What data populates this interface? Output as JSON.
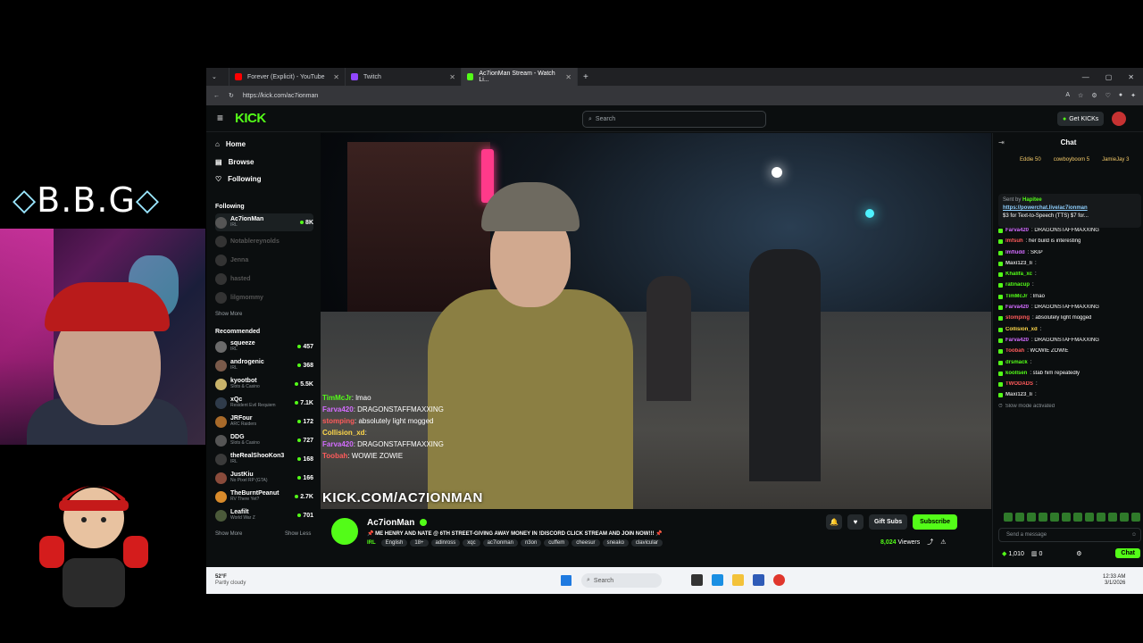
{
  "overlay": {
    "brand_text": "B.B.G"
  },
  "browser": {
    "tabs": [
      {
        "label": "Forever (Explicit) - YouTube",
        "active": false,
        "favicon_color": "#ff0000"
      },
      {
        "label": "Twitch",
        "active": false,
        "favicon_color": "#9146ff"
      },
      {
        "label": "Ac7ionMan Stream - Watch Li...",
        "active": true,
        "favicon_color": "#53fc18"
      }
    ],
    "url": "https://kick.com/ac7ionman"
  },
  "kick": {
    "logo": "KICK",
    "search_placeholder": "Search",
    "get_kicks_label": "Get KICKs",
    "nav": [
      {
        "label": "Home",
        "icon": "home-icon"
      },
      {
        "label": "Browse",
        "icon": "browse-icon"
      },
      {
        "label": "Following",
        "icon": "heart-icon"
      }
    ],
    "following_title": "Following",
    "following": [
      {
        "name": "Ac7ionMan",
        "category": "IRL",
        "viewers": "8K",
        "live": true
      },
      {
        "name": "Notablereynolds",
        "category": "",
        "viewers": "",
        "live": false
      },
      {
        "name": "Jenna",
        "category": "",
        "viewers": "",
        "live": false
      },
      {
        "name": "hasted",
        "category": "",
        "viewers": "",
        "live": false
      },
      {
        "name": "lilgmommy",
        "category": "",
        "viewers": "",
        "live": false
      }
    ],
    "show_more": "Show More",
    "recommended_title": "Recommended",
    "recommended": [
      {
        "name": "squeeze",
        "category": "IRL",
        "viewers": "457"
      },
      {
        "name": "androgenic",
        "category": "IRL",
        "viewers": "368"
      },
      {
        "name": "kyootbot",
        "category": "Slots & Casino",
        "viewers": "5.5K"
      },
      {
        "name": "xQc",
        "category": "Resident Evil Requiem",
        "viewers": "7.1K"
      },
      {
        "name": "JRFour",
        "category": "ARC Raiders",
        "viewers": "172"
      },
      {
        "name": "DDG",
        "category": "Slots & Casino",
        "viewers": "727"
      },
      {
        "name": "theRealShooKon3",
        "category": "IRL",
        "viewers": "168"
      },
      {
        "name": "JustKiu",
        "category": "No Pixel RP (GTA)",
        "viewers": "166"
      },
      {
        "name": "TheBurntPeanut",
        "category": "RV There Yet?",
        "viewers": "2.7K"
      },
      {
        "name": "Leafilt",
        "category": "World War Z",
        "viewers": "701"
      }
    ],
    "show_more_2": "Show More",
    "show_less": "Show Less"
  },
  "video": {
    "overlay_chat": [
      {
        "user": "TimMcJr",
        "text": ": lmao",
        "color": "#53fc18"
      },
      {
        "user": "Farva420",
        "text": ": DRAGONSTAFFMAXXING",
        "color": "#d36cff"
      },
      {
        "user": "stomping",
        "text": ": absolutely light mogged",
        "color": "#ff5b5b"
      },
      {
        "user": "Collision_xd",
        "text": ":",
        "color": "#ffd84a"
      },
      {
        "user": "Farva420",
        "text": ": DRAGONSTAFFMAXXING",
        "color": "#d36cff"
      },
      {
        "user": "Toobah",
        "text": ": WOWIE ZOWIE",
        "color": "#ff5b5b"
      }
    ],
    "overlay_url": "KICK.COM/AC7IONMAN"
  },
  "stream": {
    "name": "Ac7ionMan",
    "title": "📌 ME HENRY AND NATE @ 6TH STREET-GIVING AWAY MONEY IN !DISCORD CLICK STREAM AND JOIN NOW!!! 📌",
    "category": "IRL",
    "tags": [
      "English",
      "18+",
      "adinross",
      "xqc",
      "ac7ionman",
      "n3on",
      "cuffem",
      "cheesur",
      "sneako",
      "clavicular"
    ],
    "gift_label": "Gift Subs",
    "subscribe_label": "Subscribe",
    "viewers": "8,024",
    "viewers_label": "Viewers"
  },
  "chat": {
    "title": "Chat",
    "leaders": [
      {
        "name": "Eddie",
        "value": "50"
      },
      {
        "name": "cowboyboom",
        "value": "5"
      },
      {
        "name": "JamieJay",
        "value": "3"
      }
    ],
    "pinned_by_label": "Sent by",
    "pinned_user": "Hapitee",
    "pinned_link": "https://powerchat.live/ac7ionman",
    "pinned_text": "$3 for Text-to-Speech (TTS) $7 for...",
    "messages": [
      {
        "user": "Farva420",
        "text": ": DRAGONSTAFFMAXXING",
        "color": "#d36cff"
      },
      {
        "user": "lmfsuh",
        "text": ": her build is interesting",
        "color": "#ff5b5b"
      },
      {
        "user": "lmfludd",
        "text": ": SKIP",
        "color": "#d36cff"
      },
      {
        "user": "Maxi123_li",
        "text": ":",
        "color": "#cfcfcf"
      },
      {
        "user": "Khalifa_xc",
        "text": ":",
        "color": "#53fc18"
      },
      {
        "user": "ratinacup",
        "text": ":",
        "color": "#53fc18"
      },
      {
        "user": "TimMcJr",
        "text": ": lmao",
        "color": "#53fc18"
      },
      {
        "user": "Farva420",
        "text": ": DRAGONSTAFFMAXXING",
        "color": "#d36cff"
      },
      {
        "user": "stomping",
        "text": ": absolutely light mogged",
        "color": "#ff5b5b"
      },
      {
        "user": "Collision_xd",
        "text": ":",
        "color": "#ffd84a"
      },
      {
        "user": "Farva420",
        "text": ": DRAGONSTAFFMAXXING",
        "color": "#d36cff"
      },
      {
        "user": "Toobah",
        "text": ": WOWIE ZOWIE",
        "color": "#ff5b5b"
      },
      {
        "user": "drsmack",
        "text": ":",
        "color": "#53fc18"
      },
      {
        "user": "koollsen",
        "text": ": stab him repeatedly",
        "color": "#53fc18"
      },
      {
        "user": "TWODADS",
        "text": ":",
        "color": "#ff5b5b"
      },
      {
        "user": "Maxi123_li",
        "text": ":",
        "color": "#cfcfcf"
      },
      {
        "user": "",
        "text": "Slow mode activated",
        "color": "#8a9196"
      }
    ],
    "input_placeholder": "Send a message",
    "points": "1,010",
    "zero": "0",
    "chat_button": "Chat"
  },
  "taskbar": {
    "temperature": "52°F",
    "condition": "Partly cloudy",
    "search_placeholder": "Search",
    "time": "12:33 AM",
    "date": "3/1/2026"
  }
}
